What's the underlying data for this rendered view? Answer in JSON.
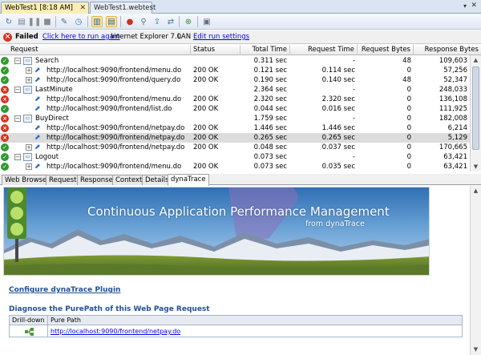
{
  "tabs": [
    {
      "label": "WebTest1 [8:18 AM]",
      "active": true
    },
    {
      "label": "WebTest1.webtest",
      "active": false
    }
  ],
  "toolbar": {
    "buttons": [
      "refresh-icon",
      "edit-run-icon",
      "pause-icon",
      "stop-icon",
      "edit-test-icon",
      "history-icon",
      "layout-horizontal-icon",
      "layout-vertical-icon",
      "dynatrace-icon",
      "find-icon",
      "export-icon",
      "parameterize-icon",
      "add-dependency-icon",
      "save-icon"
    ]
  },
  "status": {
    "result": "Failed",
    "run_again_link": "Click here to run again",
    "browser": "Internet Explorer 7.0",
    "network": "LAN",
    "edit_settings_link": "Edit run settings"
  },
  "grid": {
    "columns": [
      "Request",
      "Status",
      "Total Time",
      "Request Time",
      "Request Bytes",
      "Response Bytes"
    ],
    "rows": [
      {
        "result": "pass",
        "level": 0,
        "kind": "page",
        "expander": "−",
        "name": "Search",
        "status": "",
        "total": "0.311 sec",
        "req_time": "-",
        "req_bytes": "48",
        "resp_bytes": "109,603",
        "selected": false
      },
      {
        "result": "pass",
        "level": 1,
        "kind": "request",
        "expander": "+",
        "name": "http://localhost:9090/frontend/menu.do",
        "status": "200 OK",
        "total": "0.121 sec",
        "req_time": "0.114 sec",
        "req_bytes": "0",
        "resp_bytes": "57,256",
        "selected": false
      },
      {
        "result": "pass",
        "level": 1,
        "kind": "request",
        "expander": "+",
        "name": "http://localhost:9090/frontend/query.do",
        "status": "200 OK",
        "total": "0.190 sec",
        "req_time": "0.140 sec",
        "req_bytes": "48",
        "resp_bytes": "52,347",
        "selected": false
      },
      {
        "result": "fail",
        "level": 0,
        "kind": "page",
        "expander": "−",
        "name": "LastMinute",
        "status": "",
        "total": "2.364 sec",
        "req_time": "-",
        "req_bytes": "0",
        "resp_bytes": "248,033",
        "selected": false
      },
      {
        "result": "fail",
        "level": 1,
        "kind": "request",
        "expander": "",
        "name": "http://localhost:9090/frontend/menu.do",
        "status": "200 OK",
        "total": "2.320 sec",
        "req_time": "2.320 sec",
        "req_bytes": "0",
        "resp_bytes": "136,108",
        "selected": false
      },
      {
        "result": "pass",
        "level": 1,
        "kind": "request",
        "expander": "",
        "name": "http://localhost:9090/frontend/list.do",
        "status": "200 OK",
        "total": "0.044 sec",
        "req_time": "0.016 sec",
        "req_bytes": "0",
        "resp_bytes": "111,925",
        "selected": false
      },
      {
        "result": "fail",
        "level": 0,
        "kind": "page",
        "expander": "−",
        "name": "BuyDirect",
        "status": "",
        "total": "1.759 sec",
        "req_time": "-",
        "req_bytes": "0",
        "resp_bytes": "182,008",
        "selected": false
      },
      {
        "result": "fail",
        "level": 1,
        "kind": "request",
        "expander": "",
        "name": "http://localhost:9090/frontend/netpay.do",
        "status": "200 OK",
        "total": "1.446 sec",
        "req_time": "1.446 sec",
        "req_bytes": "0",
        "resp_bytes": "6,214",
        "selected": false
      },
      {
        "result": "fail",
        "level": 1,
        "kind": "request",
        "expander": "",
        "name": "http://localhost:9090/frontend/netpay.do",
        "status": "200 OK",
        "total": "0.265 sec",
        "req_time": "0.265 sec",
        "req_bytes": "0",
        "resp_bytes": "5,129",
        "selected": true
      },
      {
        "result": "pass",
        "level": 1,
        "kind": "request",
        "expander": "+",
        "name": "http://localhost:9090/frontend/netpay.do",
        "status": "200 OK",
        "total": "0.048 sec",
        "req_time": "0.037 sec",
        "req_bytes": "0",
        "resp_bytes": "170,665",
        "selected": false
      },
      {
        "result": "pass",
        "level": 0,
        "kind": "page",
        "expander": "−",
        "name": "Logout",
        "status": "",
        "total": "0.073 sec",
        "req_time": "-",
        "req_bytes": "0",
        "resp_bytes": "63,421",
        "selected": false
      },
      {
        "result": "pass",
        "level": 1,
        "kind": "request",
        "expander": "+",
        "name": "http://localhost:9090/frontend/menu.do",
        "status": "200 OK",
        "total": "0.073 sec",
        "req_time": "0.035 sec",
        "req_bytes": "0",
        "resp_bytes": "63,421",
        "selected": false
      }
    ]
  },
  "bottom_tabs": [
    {
      "label": "Web Browser",
      "active": false
    },
    {
      "label": "Request",
      "active": false
    },
    {
      "label": "Response",
      "active": false
    },
    {
      "label": "Context",
      "active": false
    },
    {
      "label": "Details",
      "active": false
    },
    {
      "label": "dynaTrace",
      "active": true
    }
  ],
  "browser": {
    "banner_title": "Continuous Application Performance Management",
    "banner_subtitle": "from dynaTrace",
    "configure_link": "Configure dynaTrace Plugin",
    "diagnose_title": "Diagnose the PurePath of this Web Page Request",
    "table_headers": [
      "Drill-down",
      "Pure Path"
    ],
    "purepath_link": "http://localhost:9090/frontend/netpay.do"
  },
  "colors": {
    "pass": "#2f9a2f",
    "fail": "#d9331f",
    "link": "#0000ee",
    "heading_blue": "#1f4f9a",
    "tab_active": "#fbeeb5"
  }
}
